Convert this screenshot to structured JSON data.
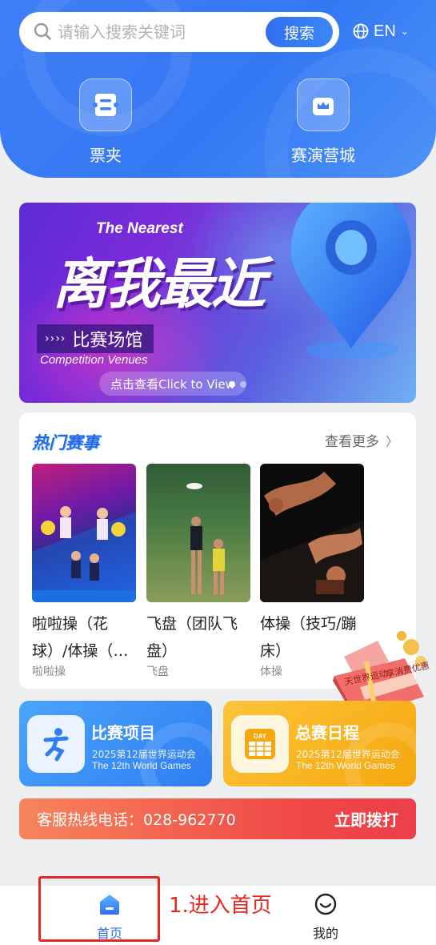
{
  "search": {
    "placeholder": "请输入搜索关键词",
    "button": "搜索"
  },
  "language": {
    "label": "EN",
    "icon": "globe-icon"
  },
  "quick_actions": [
    {
      "label": "票夹",
      "icon": "ticket-wallet-icon"
    },
    {
      "label": "赛演营城",
      "icon": "crown-icon"
    }
  ],
  "banner": {
    "en_title": "The Nearest",
    "cn_title": "离我最近",
    "tag": "比赛场馆",
    "arrows": "››››",
    "en_sub": "Competition Venues",
    "cta": "点击查看Click to View",
    "slide_count": 2,
    "active_slide": 1
  },
  "hot_events": {
    "title": "热门赛事",
    "more": "查看更多",
    "items": [
      {
        "name": "啦啦操（花球）/体操（…",
        "category": "啦啦操"
      },
      {
        "name": "飞盘（团队飞盘）",
        "category": "飞盘"
      },
      {
        "name": "体操（技巧/蹦床）",
        "category": "体操"
      }
    ]
  },
  "gift_badge": {
    "text1": "天世界运动",
    "text2": "享消费优惠"
  },
  "tiles": [
    {
      "title": "比赛项目",
      "line1": "2025第12届世界运动会",
      "line2": "The 12th World Games",
      "icon": "sport-figure-icon",
      "color": "#3a8ff5"
    },
    {
      "title": "总赛日程",
      "line1": "2025第12届世界运动会",
      "line2": "The 12th World Games",
      "icon": "calendar-icon",
      "badge": "DAY",
      "color": "#f8b419"
    }
  ],
  "hotline": {
    "text": "客服热线电话：028-962770",
    "action": "立即拨打"
  },
  "tabbar": [
    {
      "label": "首页",
      "icon": "home-icon",
      "active": true
    },
    {
      "label": "我的",
      "icon": "smiley-icon",
      "active": false
    }
  ],
  "annotation": {
    "text": "1.进入首页",
    "color": "#e5271f"
  }
}
